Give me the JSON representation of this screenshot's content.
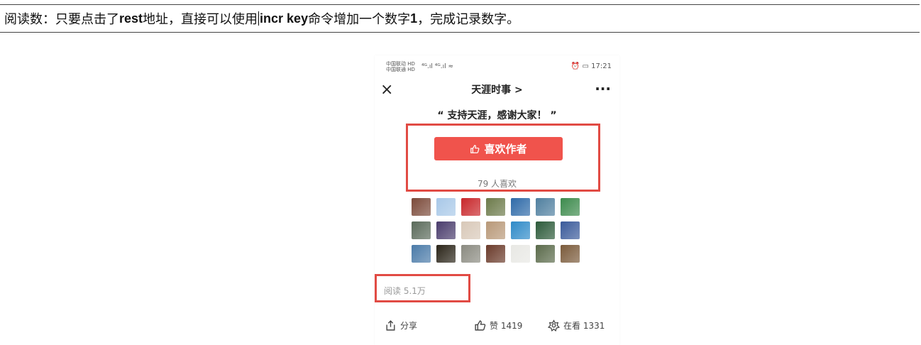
{
  "doc": {
    "text_before": "阅读数：只要点击了",
    "rest": "rest",
    "text_mid": "地址，直接可以使用",
    "cmd": "incr key",
    "text_after": " 命令增加一个数字",
    "num": "1",
    "text_end": "，完成记录数字。"
  },
  "phone": {
    "status": {
      "carrier1": "中国联动 HD",
      "carrier2": "中国联通 HD",
      "signals": "⁴ᴳ.ıl ⁴ᴳ.ıl ≈",
      "time": "⏰ ▭ 17:21"
    },
    "nav": {
      "title": "天涯时事 >",
      "more": "···",
      "close": "×"
    },
    "quote": "“ 支持天涯，感谢大家！ ”",
    "like_button": "喜欢作者",
    "like_count": "79 人喜欢",
    "read_count": "阅读 5.1万",
    "actions": {
      "share": "分享",
      "zan": "赞 1419",
      "watch": "在看 1331"
    },
    "avatar_colors": [
      [
        "#7b4a3a",
        "#a8c8e8",
        "#c8262a",
        "#6c7a4a",
        "#2e6aa8",
        "#4f7f9f",
        "#3c8a4c"
      ],
      [
        "#5a6a5a",
        "#4a3c6c",
        "#d8c8b8",
        "#b89878",
        "#2e8ac8",
        "#2c5a3a",
        "#3a5a9a"
      ],
      [
        "#4a7aa8",
        "#2a2418",
        "#8a8a80",
        "#6a3a2a",
        "#e8e8e4",
        "#5a6a4a",
        "#7a5a3a"
      ]
    ],
    "accent": "#f0534c",
    "highlight": "#e14b44"
  }
}
